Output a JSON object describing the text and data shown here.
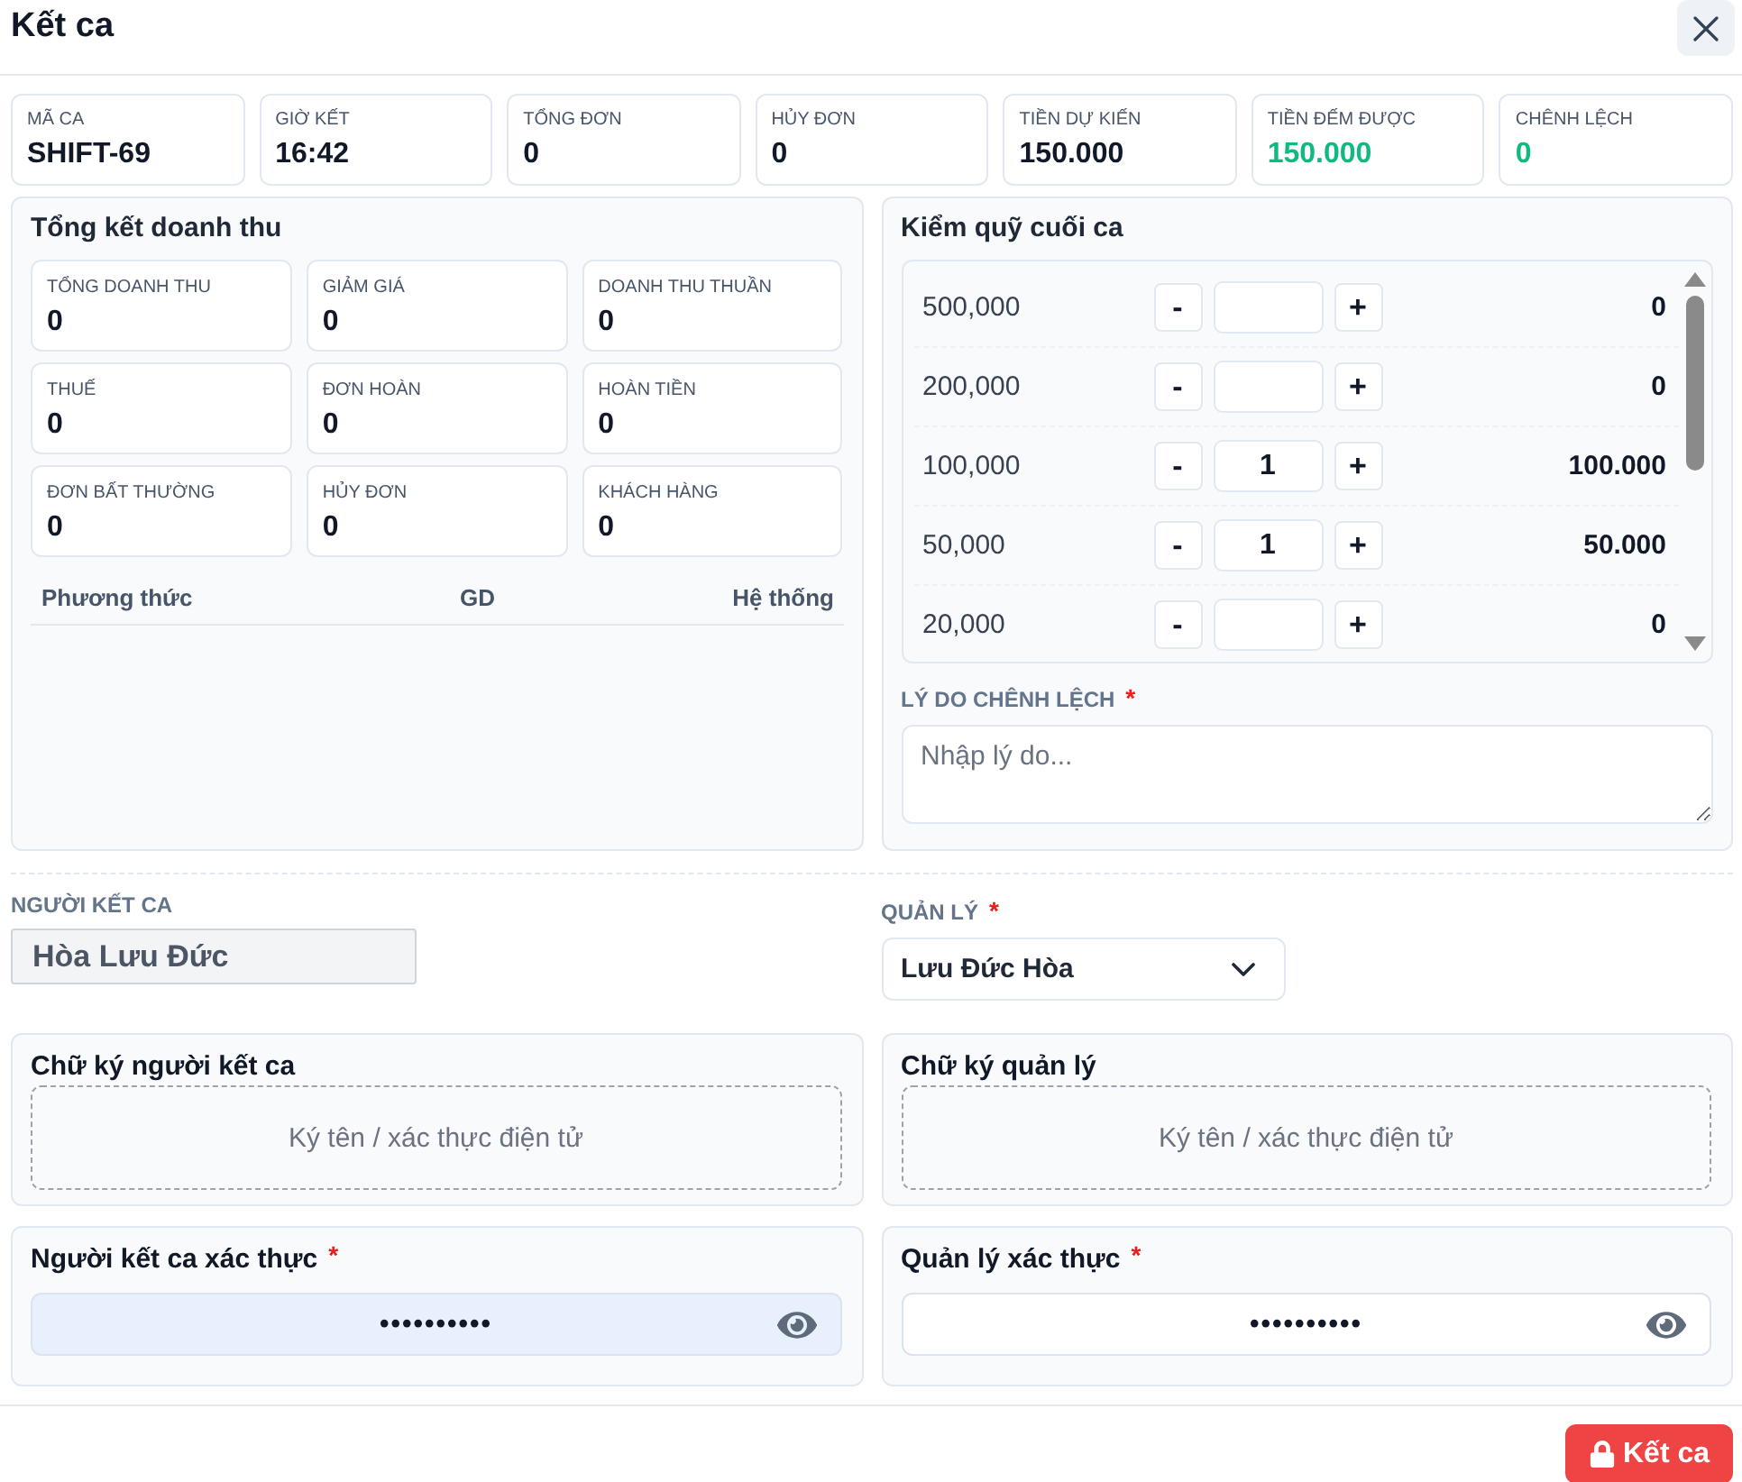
{
  "dialog": {
    "title": "Kết ca"
  },
  "summary": [
    {
      "label": "MÃ CA",
      "value": "SHIFT-69",
      "color": "#111827"
    },
    {
      "label": "GIỜ KẾT",
      "value": "16:42",
      "color": "#111827"
    },
    {
      "label": "TỔNG ĐƠN",
      "value": "0",
      "color": "#111827"
    },
    {
      "label": "HỦY ĐƠN",
      "value": "0",
      "color": "#111827"
    },
    {
      "label": "TIỀN DỰ KIẾN",
      "value": "150.000",
      "color": "#111827"
    },
    {
      "label": "TIỀN ĐẾM ĐƯỢC",
      "value": "150.000",
      "color": "#10b981"
    },
    {
      "label": "CHÊNH LỆCH",
      "value": "0",
      "color": "#10b981"
    }
  ],
  "revenue": {
    "title": "Tổng kết doanh thu",
    "stats": [
      {
        "label": "TỔNG DOANH THU",
        "value": "0"
      },
      {
        "label": "GIẢM GIÁ",
        "value": "0"
      },
      {
        "label": "DOANH THU THUẦN",
        "value": "0"
      },
      {
        "label": "THUẾ",
        "value": "0"
      },
      {
        "label": "ĐƠN HOÀN",
        "value": "0"
      },
      {
        "label": "HOÀN TIỀN",
        "value": "0"
      },
      {
        "label": "ĐƠN BẤT THƯỜNG",
        "value": "0"
      },
      {
        "label": "HỦY ĐƠN",
        "value": "0"
      },
      {
        "label": "KHÁCH HÀNG",
        "value": "0"
      }
    ],
    "table": {
      "columns": [
        "Phương thức",
        "GD",
        "Hệ thống"
      ]
    }
  },
  "cash_count": {
    "title": "Kiểm quỹ cuối ca",
    "denominations": [
      {
        "denomination": "500,000",
        "minus": "-",
        "plus": "+",
        "amount": "0"
      },
      {
        "denomination": "200,000",
        "minus": "-",
        "plus": "+",
        "amount": "0"
      },
      {
        "denomination": "100,000",
        "minus": "-",
        "quantity": "1",
        "plus": "+",
        "amount": "100.000"
      },
      {
        "denomination": "50,000",
        "minus": "-",
        "quantity": "1",
        "plus": "+",
        "amount": "50.000"
      },
      {
        "denomination": "20,000",
        "minus": "-",
        "plus": "+",
        "amount": "0"
      }
    ],
    "reason": {
      "label": "LÝ DO CHÊNH LỆCH",
      "required_mark": "*",
      "placeholder": "Nhập lý do..."
    }
  },
  "cashier": {
    "label": "NGƯỜI KẾT CA",
    "value": "Hòa Lưu Đức",
    "readonly": true
  },
  "manager": {
    "label": "QUẢN LÝ",
    "required_mark": "*",
    "value": "Lưu Đức Hòa"
  },
  "signatures": [
    {
      "title": "Chữ ký người kết ca",
      "placeholder": "Ký tên / xác thực điện tử"
    },
    {
      "title": "Chữ ký quản lý",
      "placeholder": "Ký tên / xác thực điện tử"
    }
  ],
  "authentication": [
    {
      "label": "Người kết ca xác thực",
      "required_mark": "*",
      "value": "••••••••••",
      "autofilled": true
    },
    {
      "label": "Quản lý xác thực",
      "required_mark": "*",
      "value": "••••••••••",
      "autofilled": false
    }
  ],
  "actions": {
    "submit": "Kết ca"
  }
}
